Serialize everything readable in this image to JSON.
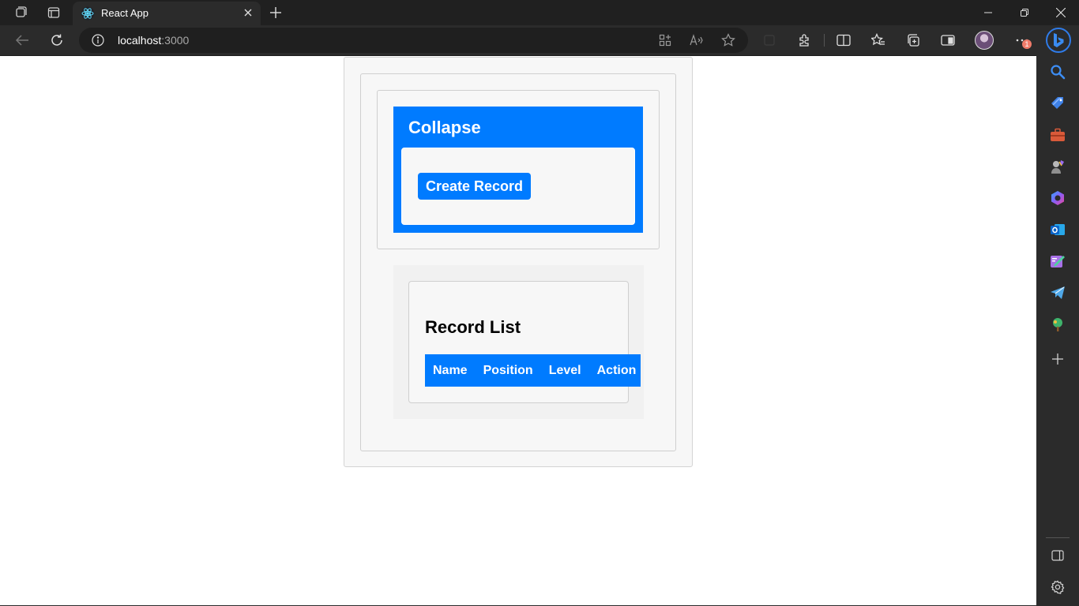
{
  "browser": {
    "tab": {
      "title": "React App"
    },
    "address": {
      "host": "localhost",
      "port": ":3000"
    },
    "notification_count": "1"
  },
  "page": {
    "collapse": {
      "title": "Collapse",
      "create_button_label": "Create Record"
    },
    "record_list": {
      "title": "Record List",
      "columns": [
        "Name",
        "Position",
        "Level",
        "Action"
      ]
    }
  },
  "colors": {
    "primary": "#007bff",
    "card_bg": "#f7f7f7",
    "browser_chrome": "#2b2b2b",
    "tabstrip": "#202020"
  },
  "icons": {
    "sidebar": [
      "search-icon",
      "shopping-tag-icon",
      "tools-icon",
      "games-icon",
      "copilot-icon",
      "outlook-icon",
      "designer-icon",
      "telegram-icon",
      "tree-icon",
      "add-icon",
      "sidebar-toggle-icon",
      "settings-icon"
    ]
  }
}
